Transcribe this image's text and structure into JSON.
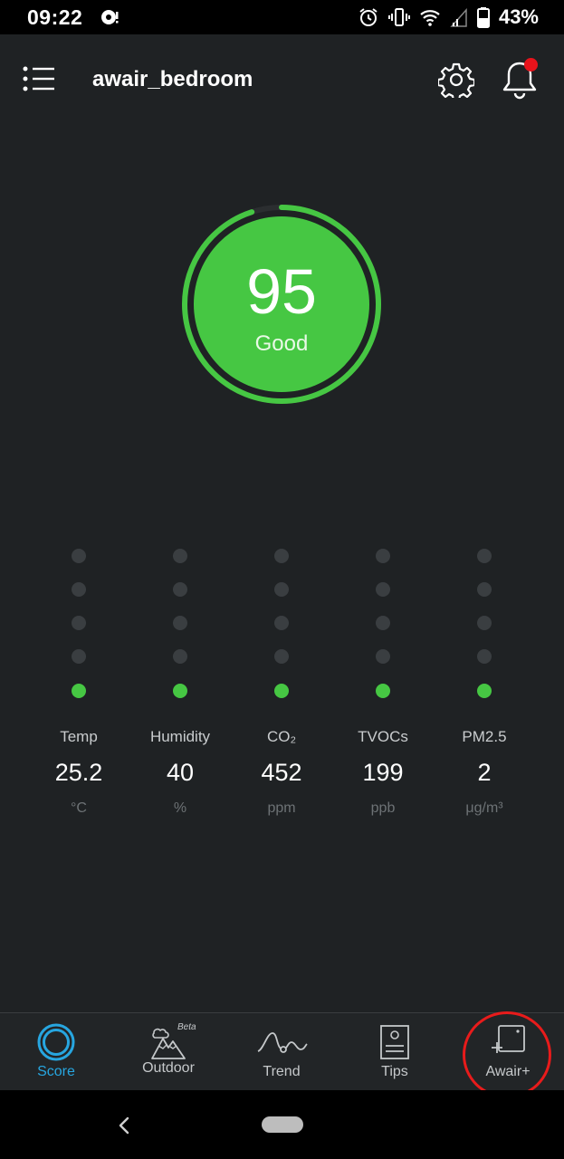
{
  "status_bar": {
    "time": "09:22",
    "battery_percent": "43%"
  },
  "header": {
    "device_name": "awair_bedroom",
    "has_notification": true
  },
  "score": {
    "value": "95",
    "label": "Good",
    "fraction": 0.95,
    "color": "#46c743"
  },
  "sensors": [
    {
      "name": "Temp",
      "value": "25.2",
      "unit": "°C",
      "level": 1
    },
    {
      "name": "Humidity",
      "value": "40",
      "unit": "%",
      "level": 1
    },
    {
      "name": "CO₂",
      "value": "452",
      "unit": "ppm",
      "level": 1
    },
    {
      "name": "TVOCs",
      "value": "199",
      "unit": "ppb",
      "level": 1
    },
    {
      "name": "PM2.5",
      "value": "2",
      "unit": "μg/m³",
      "level": 1
    }
  ],
  "bottom_nav": {
    "items": [
      {
        "label": "Score",
        "icon": "score-ring-icon",
        "active": true
      },
      {
        "label": "Outdoor",
        "icon": "mountain-icon",
        "badge": "Beta",
        "active": false
      },
      {
        "label": "Trend",
        "icon": "wave-icon",
        "active": false
      },
      {
        "label": "Tips",
        "icon": "document-icon",
        "active": false
      },
      {
        "label": "Awair+",
        "icon": "add-device-icon",
        "active": false
      }
    ]
  },
  "colors": {
    "background": "#1f2224",
    "good": "#46c743",
    "accent": "#27a6e0",
    "inactive_dot": "#3a3e41"
  }
}
